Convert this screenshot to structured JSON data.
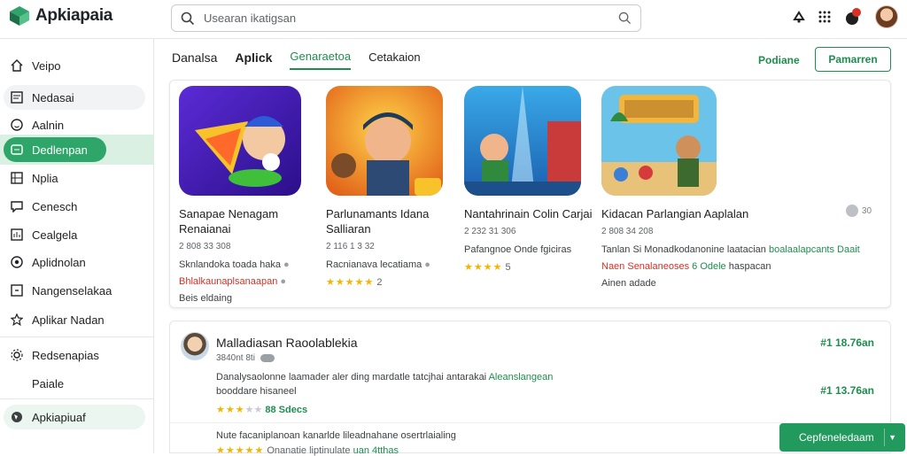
{
  "app": {
    "name": "Apkiapaia"
  },
  "search": {
    "placeholder": "Usearan ikatigsan"
  },
  "sidebar": {
    "items": [
      {
        "label": "Veipo",
        "icon": "home-icon"
      },
      {
        "label": "Nedasai",
        "icon": "news-icon"
      },
      {
        "label": "Aalnin",
        "icon": "smiley-icon"
      },
      {
        "label": "Dedlenpan",
        "icon": "apps-icon"
      },
      {
        "label": "Nplia",
        "icon": "grid-icon"
      },
      {
        "label": "Cenesch",
        "icon": "comment-icon"
      },
      {
        "label": "Cealgela",
        "icon": "chart-icon"
      },
      {
        "label": "Aplidnolan",
        "icon": "target-icon"
      },
      {
        "label": "Nangenselakaa",
        "icon": "box-icon"
      },
      {
        "label": "Aplikar Nadan",
        "icon": "star-icon"
      },
      {
        "label": "Redsenapias",
        "icon": "settings-icon"
      },
      {
        "label": "Paiale",
        "icon": ""
      },
      {
        "label": "Apkiapiuaf",
        "icon": "globe-icon"
      }
    ]
  },
  "tabs": [
    {
      "label": "Danalsa"
    },
    {
      "label": "Aplick"
    },
    {
      "label": "Genaraetoa"
    },
    {
      "label": "Cetakaion"
    }
  ],
  "header": {
    "link": "Podiane",
    "button": "Pamarren"
  },
  "apps": [
    {
      "title": "Sanapae Nenagam Renaianai",
      "meta": "2 808 33 308",
      "desc": "Sknlandoka toada haka",
      "line1": "Bhlalkaunaplsanaapan",
      "line2": "Beis eldaing"
    },
    {
      "title": "Parlunamants Idana Salliaran",
      "meta": "2 116 1 3 32",
      "desc": "Racnianava lecatiama",
      "rating": "2"
    },
    {
      "title": "Nantahrinain Colin Carjai",
      "meta": "2 232 31 306",
      "desc": "Pafangnoe Onde fgiciras",
      "rating": "5"
    },
    {
      "title": "Kidacan Parlangian Aaplalan",
      "meta": "2 808 34 208",
      "desc": "Tanlan Si Monadkodanonine laatacian",
      "desc_green": "boalaalapcants Daait",
      "line1_red": "Naen Senalaneoses",
      "line1_green": "6 Odele",
      "line1_rest": "haspacan",
      "line2": "Ainen adade"
    }
  ],
  "more": {
    "label": "30"
  },
  "review": {
    "title": "Malladiasan Raoolablekia",
    "meta": "3840nt 8ti",
    "price1": "#1 18.76an",
    "text1": "Danalysaolonne laamader aler ding mardatle tatcjhai antarakai",
    "text1_green": "Aleanslangean",
    "text2": "booddare hisaneel",
    "rating_text": "88 Sdecs",
    "price2": "#1 13.76an",
    "text3": "Nute facaniplanoan kanarlde lileadnahane osertrlaialing",
    "text4_a": "Onanatie liptinulate",
    "text4_b": "uan 4tthas"
  },
  "cta": {
    "label": "Cepfeneledaam"
  },
  "colors": {
    "accent": "#1e8e4e",
    "active_bg": "#2ea66a",
    "star": "#f5b400"
  }
}
